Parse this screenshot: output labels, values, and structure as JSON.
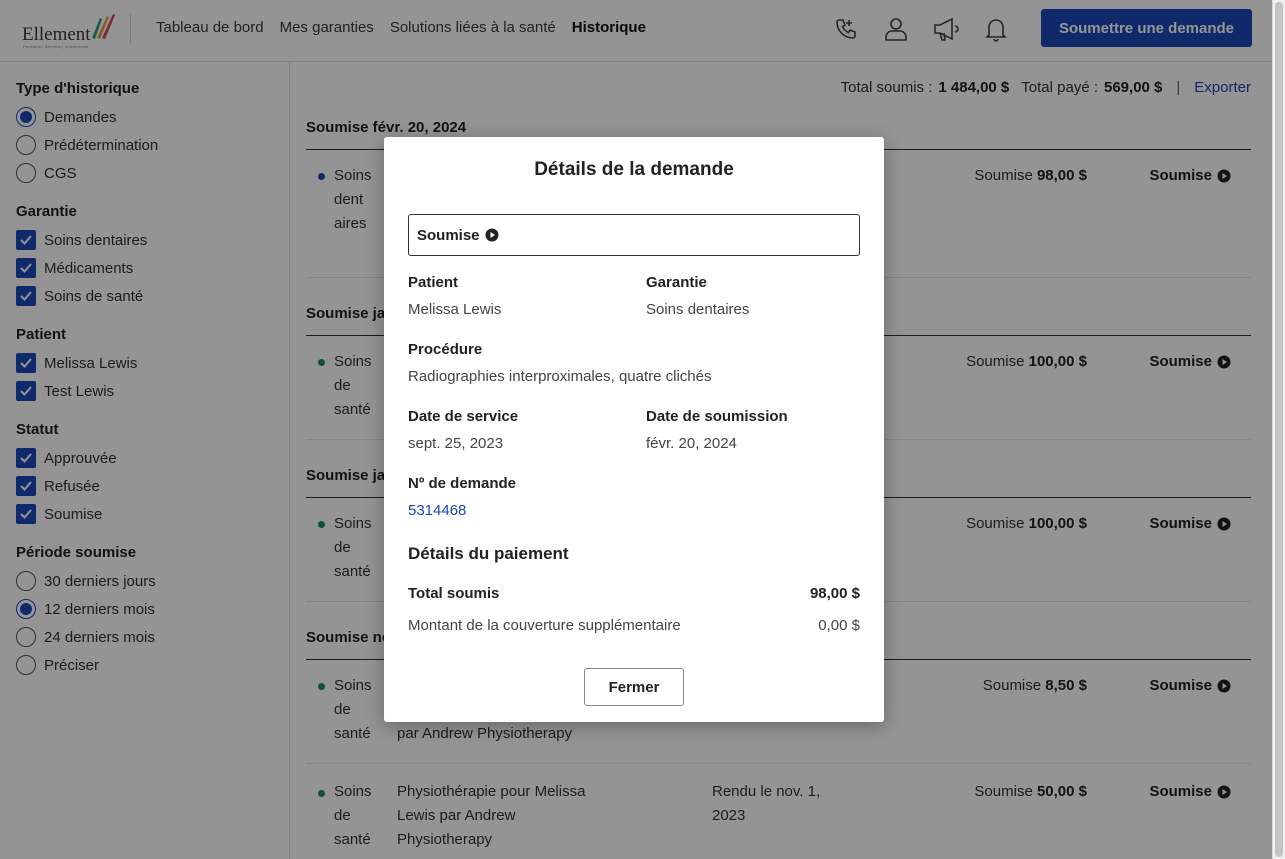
{
  "header": {
    "logo_text": "Ellement",
    "logo_sub": "Pensions | Benefits | Investments",
    "nav": [
      "Tableau de bord",
      "Mes garanties",
      "Solutions liées à la santé",
      "Historique"
    ],
    "submit_label": "Soumettre une demande",
    "icons": [
      "phone-icon",
      "profile-icon",
      "megaphone-icon",
      "bell-icon"
    ]
  },
  "sidebar": {
    "history_type": {
      "title": "Type d'historique",
      "options": [
        "Demandes",
        "Prédétermination",
        "CGS"
      ],
      "selected": "Demandes"
    },
    "coverage": {
      "title": "Garantie",
      "options": [
        "Soins dentaires",
        "Médicaments",
        "Soins de santé"
      ]
    },
    "patient": {
      "title": "Patient",
      "options": [
        "Melissa Lewis",
        "Test Lewis"
      ]
    },
    "status": {
      "title": "Statut",
      "options": [
        "Approuvée",
        "Refusée",
        "Soumise"
      ]
    },
    "period": {
      "title": "Période soumise",
      "options": [
        "30 derniers jours",
        "12 derniers mois",
        "24 derniers mois",
        "Préciser"
      ],
      "selected": "12 derniers mois"
    }
  },
  "main": {
    "totals": {
      "submitted_label": "Total soumis :",
      "submitted_value": "1 484,00 $",
      "paid_label": "Total payé :",
      "paid_value": "569,00 $",
      "separator": "|",
      "export_label": "Exporter"
    },
    "groups": [
      {
        "heading": "Soumise févr. 20, 2024"
      },
      {
        "heading": "Soumise ja"
      },
      {
        "heading": "Soumise ja"
      },
      {
        "heading": "Soumise no"
      }
    ],
    "claims": [
      {
        "category": "Soins dent aires",
        "desc": "",
        "rendu": "",
        "amount_label": "Soumise",
        "amount": "98,00 $",
        "status": "Soumise"
      },
      {
        "category": "Soins de santé",
        "desc": "",
        "rendu": "",
        "amount_label": "Soumise",
        "amount": "100,00 $",
        "status": "Soumise"
      },
      {
        "category": "Soins de santé",
        "desc": "",
        "rendu": "",
        "amount_label": "Soumise",
        "amount": "100,00 $",
        "status": "Soumise"
      },
      {
        "category": "Soins de santé",
        "desc": "par Andrew Physiotherapy",
        "rendu": "",
        "amount_label": "Soumise",
        "amount": "8,50 $",
        "status": "Soumise"
      },
      {
        "category": "Soins de santé",
        "desc": "Physiothérapie pour Melissa Lewis par Andrew Physiotherapy",
        "rendu": "Rendu le nov. 1, 2023",
        "amount_label": "Soumise",
        "amount": "50,00 $",
        "status": "Soumise"
      }
    ],
    "colors": {
      "brand": "#1a47b8",
      "dental_dot": "#1a47b8",
      "health_dot": "#1e8a5c"
    }
  },
  "modal": {
    "title": "Détails de la demande",
    "status": "Soumise",
    "patient_label": "Patient",
    "patient_value": "Melissa Lewis",
    "coverage_label": "Garantie",
    "coverage_value": "Soins dentaires",
    "procedure_label": "Procédure",
    "procedure_value": "Radiographies interproximales, quatre clichés",
    "service_date_label": "Date de service",
    "service_date_value": "sept. 25, 2023",
    "submit_date_label": "Date de soumission",
    "submit_date_value": "févr. 20, 2024",
    "claim_no_label": "Nº de demande",
    "claim_no_value": "5314468",
    "payment_title": "Détails du paiement",
    "total_label": "Total soumis",
    "total_value": "98,00 $",
    "supp_label": "Montant de la couverture supplémentaire",
    "supp_value": "0,00 $",
    "close_label": "Fermer"
  }
}
